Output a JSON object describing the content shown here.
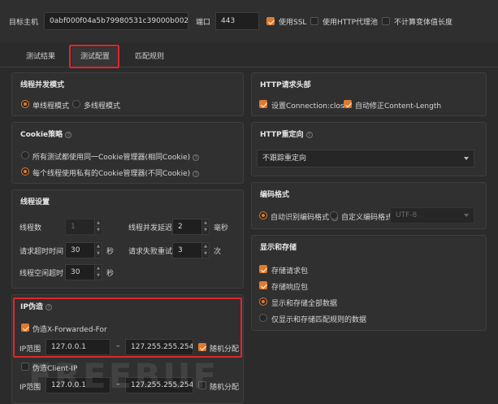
{
  "top": {
    "host_label": "目标主机",
    "host_value": "0abf000f04a5b79980531c39000b0026",
    "port_label": "端口",
    "port_value": "443",
    "ssl_label": "使用SSL",
    "ssl_checked": true,
    "proxy_label": "使用HTTP代理池",
    "proxy_checked": false,
    "nolen_label": "不计算变体值长度",
    "nolen_checked": false
  },
  "tabs": [
    {
      "label": "测试结果",
      "active": false
    },
    {
      "label": "测试配置",
      "active": true
    },
    {
      "label": "匹配规则",
      "active": false
    }
  ],
  "thread_mode": {
    "title": "线程并发模式",
    "single_label": "单线程模式",
    "multi_label": "多线程模式",
    "selected": "single"
  },
  "cookie": {
    "title": "Cookie策略",
    "shared_label": "所有测试都使用同一Cookie管理器(相同Cookie)",
    "private_label": "每个线程使用私有的Cookie管理器(不同Cookie)",
    "selected": "private"
  },
  "thread_settings": {
    "title": "线程设置",
    "thread_count_label": "线程数",
    "thread_count_value": "1",
    "delay_label": "线程并发延迟",
    "delay_value": "2",
    "delay_unit": "毫秒",
    "timeout_label": "请求超时时间",
    "timeout_value": "30",
    "timeout_unit": "秒",
    "retry_label": "请求失败重试",
    "retry_value": "3",
    "retry_unit": "次",
    "idle_label": "线程空闲超时",
    "idle_value": "30",
    "idle_unit": "秒"
  },
  "ip_spoof": {
    "title": "IP伪造",
    "xff_label": "伪造X-Forwarded-For",
    "xff_checked": true,
    "xff_range_label": "IP范围",
    "xff_from": "127.0.0.1",
    "xff_sep": "–",
    "xff_to": "127.255.255.254",
    "xff_random_label": "随机分配",
    "xff_random_checked": true,
    "client_label": "伪造Client-IP",
    "client_checked": false,
    "client_range_label": "IP范围",
    "client_from": "127.0.0.1",
    "client_sep": "–",
    "client_to": "127.255.255.254",
    "client_random_label": "随机分配",
    "client_random_checked": false
  },
  "http_headers": {
    "title": "HTTP请求头部",
    "close_label": "设置Connection:close",
    "close_checked": true,
    "fixlen_label": "自动修正Content-Length",
    "fixlen_checked": true
  },
  "redirect": {
    "title": "HTTP重定向",
    "selected_value": "不跟踪重定向"
  },
  "encoding": {
    "title": "编码格式",
    "auto_label": "自动识别编码格式",
    "custom_label": "自定义编码格式",
    "custom_value": "UTF-8",
    "selected": "auto"
  },
  "storage": {
    "title": "显示和存储",
    "save_req_label": "存储请求包",
    "save_req_checked": true,
    "save_resp_label": "存储响应包",
    "save_resp_checked": true,
    "show_all_label": "显示和存储全部数据",
    "show_match_label": "仅显示和存储匹配规则的数据",
    "selected": "all"
  },
  "watermark": "FREEBUF"
}
